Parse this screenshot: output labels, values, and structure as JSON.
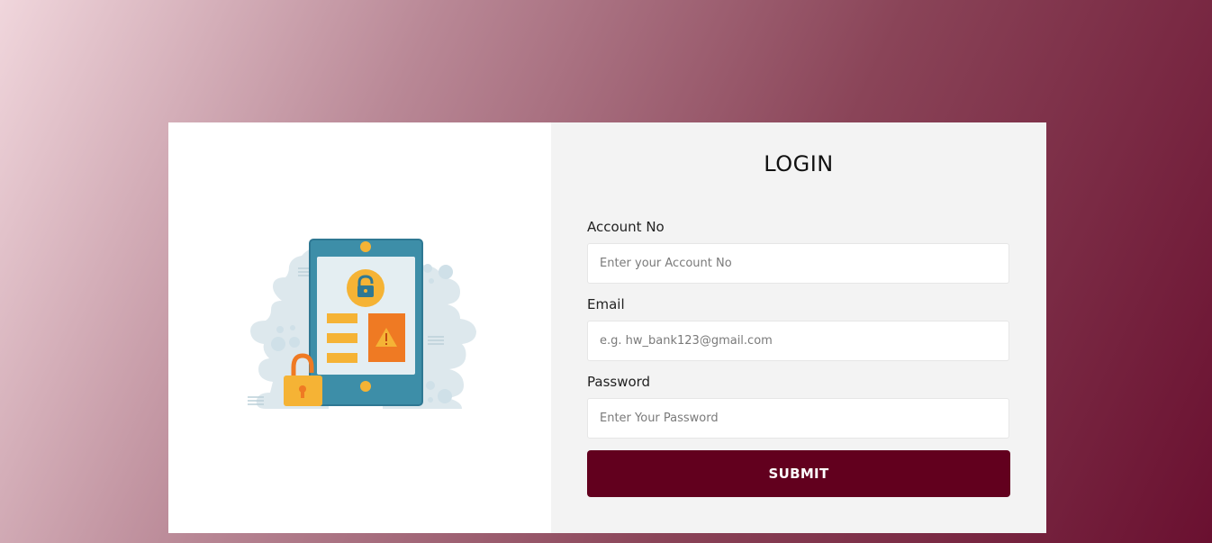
{
  "login": {
    "title": "LOGIN",
    "account": {
      "label": "Account No",
      "placeholder": "Enter your Account No",
      "value": ""
    },
    "email": {
      "label": "Email",
      "placeholder": "e.g. hw_bank123@gmail.com",
      "value": ""
    },
    "password": {
      "label": "Password",
      "placeholder": "Enter Your Password",
      "value": ""
    },
    "submit_label": "SUBMIT"
  },
  "illustration": {
    "icon": "phone-security-illustration",
    "colors": {
      "phone": "#3d8ea8",
      "screen": "#e4eef2",
      "accent": "#f5b335",
      "warning": "#ef7a23",
      "blob": "#dde8ed"
    }
  },
  "colors": {
    "primary": "#62001e",
    "panel": "#f3f3f3"
  }
}
